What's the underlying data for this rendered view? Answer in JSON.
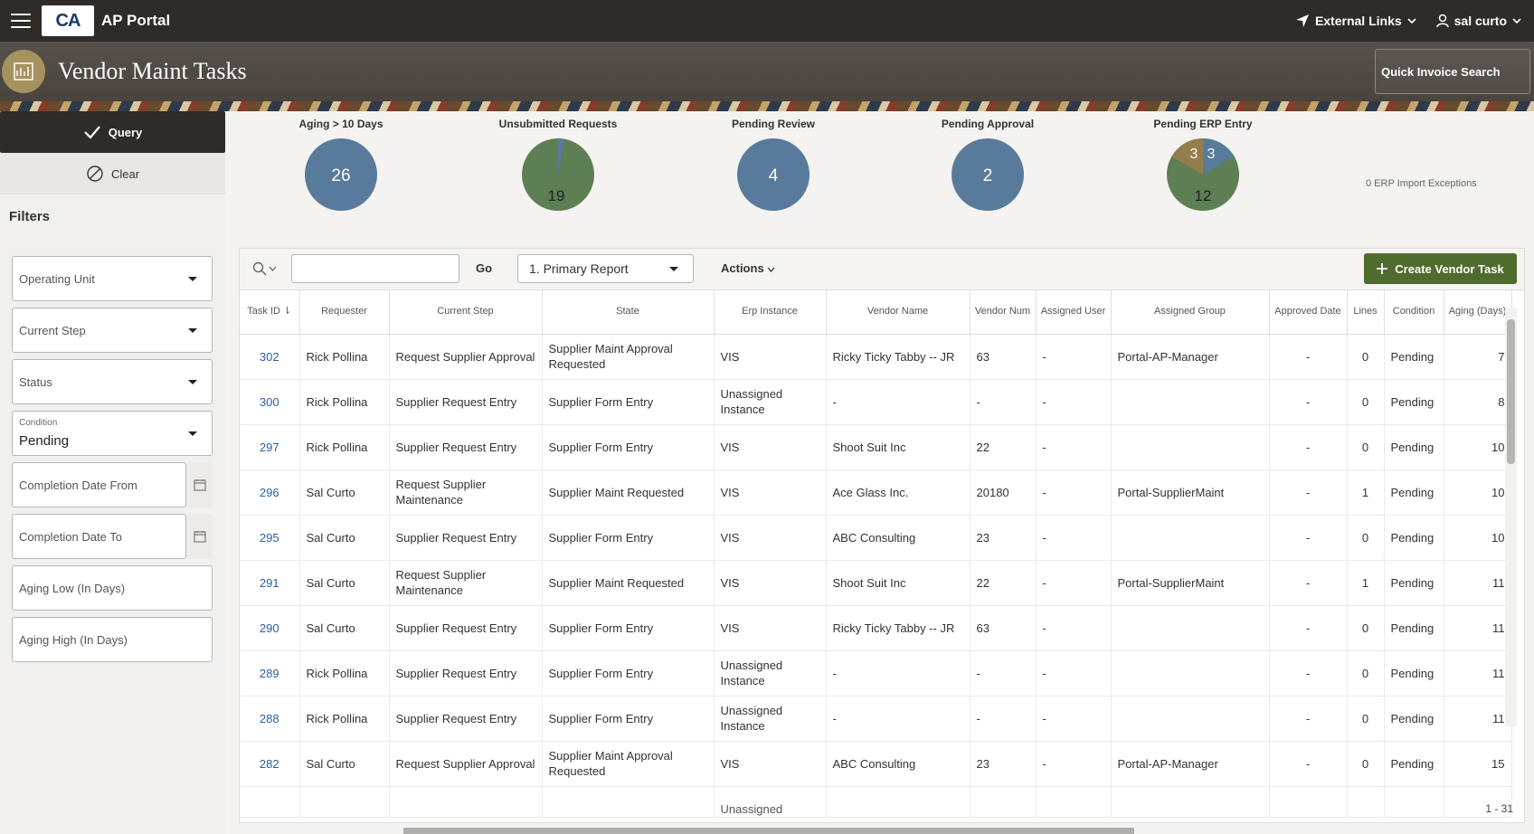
{
  "app": {
    "title": "AP Portal",
    "logo_text": "CA"
  },
  "topnav": {
    "external_links": "External Links",
    "user": "sal curto"
  },
  "header": {
    "page_title": "Vendor Maint Tasks",
    "quick_search": "Quick Invoice Search"
  },
  "sidebar": {
    "query": "Query",
    "clear": "Clear",
    "filters": "Filters",
    "operating_unit": "Operating Unit",
    "current_step": "Current Step",
    "status": "Status",
    "condition_label": "Condition",
    "condition_value": "Pending",
    "completion_from": "Completion Date From",
    "completion_to": "Completion Date To",
    "aging_low": "Aging Low (In Days)",
    "aging_high": "Aging High (In Days)"
  },
  "summary": {
    "aging_label": "Aging > 10 Days",
    "aging_value": "26",
    "unsubmitted_label": "Unsubmitted Requests",
    "unsubmitted_value": "19",
    "pending_review_label": "Pending Review",
    "pending_review_value": "4",
    "pending_approval_label": "Pending Approval",
    "pending_approval_value": "2",
    "erp_label": "Pending ERP Entry",
    "erp_values": [
      "3",
      "3",
      "12"
    ],
    "erp_note": "0 ERP Import Exceptions"
  },
  "colors": {
    "blue": "#587b9b",
    "green": "#5e7e53",
    "gold": "#937d4b",
    "brand_green": "#4f6b2d"
  },
  "toolbar": {
    "go": "Go",
    "report": "1. Primary Report",
    "actions": "Actions",
    "create": "Create Vendor Task"
  },
  "table": {
    "headers": {
      "task_id": "Task ID",
      "requester": "Requester",
      "current_step": "Current Step",
      "state": "State",
      "erp": "Erp Instance",
      "vendor_name": "Vendor Name",
      "vendor_num": "Vendor Num",
      "assigned_user": "Assigned User",
      "assigned_group": "Assigned Group",
      "approved_date": "Approved Date",
      "lines": "Lines",
      "condition": "Condition",
      "aging": "Aging (Days)"
    },
    "rows": [
      {
        "id": "302",
        "requester": "Rick Pollina",
        "step": "Request Supplier Approval",
        "state": "Supplier Maint Approval Requested",
        "erp": "VIS",
        "vendor": "Ricky Ticky Tabby -- JR",
        "num": "63",
        "user": "-",
        "group": "Portal-AP-Manager",
        "approved": "-",
        "lines": "0",
        "condition": "Pending",
        "aging": "7"
      },
      {
        "id": "300",
        "requester": "Rick Pollina",
        "step": "Supplier Request Entry",
        "state": "Supplier Form Entry",
        "erp": "Unassigned Instance",
        "vendor": "-",
        "num": "-",
        "user": "-",
        "group": "",
        "approved": "-",
        "lines": "0",
        "condition": "Pending",
        "aging": "8"
      },
      {
        "id": "297",
        "requester": "Rick Pollina",
        "step": "Supplier Request Entry",
        "state": "Supplier Form Entry",
        "erp": "VIS",
        "vendor": "Shoot Suit Inc",
        "num": "22",
        "user": "-",
        "group": "",
        "approved": "-",
        "lines": "0",
        "condition": "Pending",
        "aging": "10"
      },
      {
        "id": "296",
        "requester": "Sal Curto",
        "step": "Request Supplier Maintenance",
        "state": "Supplier Maint Requested",
        "erp": "VIS",
        "vendor": "Ace Glass Inc.",
        "num": "20180",
        "user": "-",
        "group": "Portal-SupplierMaint",
        "approved": "-",
        "lines": "1",
        "condition": "Pending",
        "aging": "10"
      },
      {
        "id": "295",
        "requester": "Sal Curto",
        "step": "Supplier Request Entry",
        "state": "Supplier Form Entry",
        "erp": "VIS",
        "vendor": "ABC Consulting",
        "num": "23",
        "user": "-",
        "group": "",
        "approved": "-",
        "lines": "0",
        "condition": "Pending",
        "aging": "10"
      },
      {
        "id": "291",
        "requester": "Sal Curto",
        "step": "Request Supplier Maintenance",
        "state": "Supplier Maint Requested",
        "erp": "VIS",
        "vendor": "Shoot Suit Inc",
        "num": "22",
        "user": "-",
        "group": "Portal-SupplierMaint",
        "approved": "-",
        "lines": "1",
        "condition": "Pending",
        "aging": "11"
      },
      {
        "id": "290",
        "requester": "Sal Curto",
        "step": "Supplier Request Entry",
        "state": "Supplier Form Entry",
        "erp": "VIS",
        "vendor": "Ricky Ticky Tabby -- JR",
        "num": "63",
        "user": "-",
        "group": "",
        "approved": "-",
        "lines": "0",
        "condition": "Pending",
        "aging": "11"
      },
      {
        "id": "289",
        "requester": "Rick Pollina",
        "step": "Supplier Request Entry",
        "state": "Supplier Form Entry",
        "erp": "Unassigned Instance",
        "vendor": "-",
        "num": "-",
        "user": "-",
        "group": "",
        "approved": "-",
        "lines": "0",
        "condition": "Pending",
        "aging": "11"
      },
      {
        "id": "288",
        "requester": "Rick Pollina",
        "step": "Supplier Request Entry",
        "state": "Supplier Form Entry",
        "erp": "Unassigned Instance",
        "vendor": "-",
        "num": "-",
        "user": "-",
        "group": "",
        "approved": "-",
        "lines": "0",
        "condition": "Pending",
        "aging": "11"
      },
      {
        "id": "282",
        "requester": "Sal Curto",
        "step": "Request Supplier Approval",
        "state": "Supplier Maint Approval Requested",
        "erp": "VIS",
        "vendor": "ABC Consulting",
        "num": "23",
        "user": "-",
        "group": "Portal-AP-Manager",
        "approved": "-",
        "lines": "0",
        "condition": "Pending",
        "aging": "15"
      }
    ],
    "partial_row": "Unassigned"
  },
  "pagination": "1 - 31"
}
